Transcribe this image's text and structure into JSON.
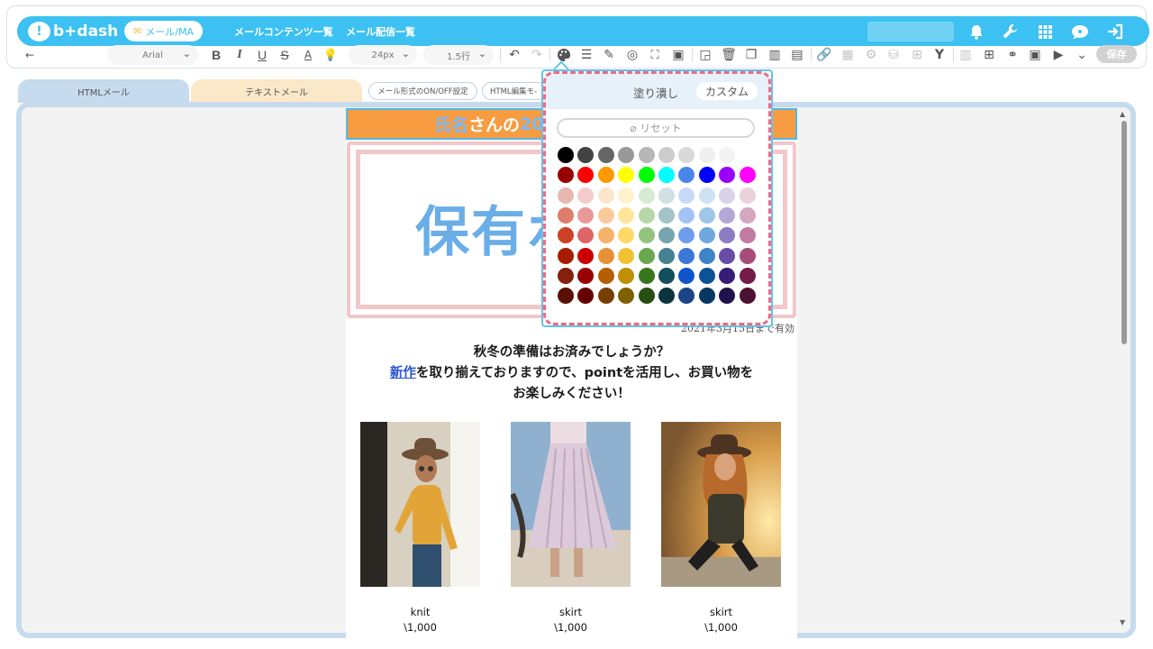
{
  "app": {
    "logo_text": "b+dash",
    "logo_mark": "!",
    "mail_pill": "メール/MA",
    "nav": {
      "contents_list": "メールコンテンツ一覧",
      "delivery_list": "メール配信一覧"
    },
    "nav_icons": [
      "bell-icon",
      "wrench-icon",
      "grid-icon",
      "chat-icon",
      "logout-icon"
    ],
    "accent": "#3cc1f2"
  },
  "toolbar": {
    "back": "←",
    "font_select": "Arial",
    "size_select": "24px",
    "line_height_select": "1.5行",
    "save_label": "保存"
  },
  "tabs": {
    "html_mail": "HTMLメール",
    "text_mail": "テキストメール",
    "onoff_btn": "メール形式のON/OFF設定",
    "html_edit_btn": "HTML編集モ-"
  },
  "email": {
    "header_name": "氏名",
    "header_suffix": "さんの",
    "header_number": "20",
    "coupon_text": "保有ポ",
    "expiry": "2021年3月15日まで有効",
    "message_line1": "秋冬の準備はお済みでしょうか？",
    "message_link": "新作",
    "message_line2_rest": "を取り揃えておりますので、pointを活用し、お買い物を",
    "message_line3": "お楽しみください！",
    "products": [
      {
        "name": "knit",
        "price": "\\1,000"
      },
      {
        "name": "skirt",
        "price": "\\1,000"
      },
      {
        "name": "skirt",
        "price": "\\1,000"
      }
    ]
  },
  "color_picker": {
    "fill_label": "塗り潰し",
    "custom_label": "カスタム",
    "reset_label": "リセット",
    "palette": [
      [
        "#000000",
        "#434343",
        "#666666",
        "#999999",
        "#b7b7b7",
        "#cccccc",
        "#d9d9d9",
        "#efefef",
        "#f3f3f3",
        "#ffffff"
      ],
      [
        "#980000",
        "#ff0000",
        "#ff9900",
        "#ffff00",
        "#00ff00",
        "#00ffff",
        "#4a86e8",
        "#0000ff",
        "#9900ff",
        "#ff00ff"
      ],
      [
        "#e6b8af",
        "#f4cccc",
        "#fce5cd",
        "#fff2cc",
        "#d9ead3",
        "#d0e0e3",
        "#c9daf8",
        "#cfe2f3",
        "#d9d2e9",
        "#ead1dc"
      ],
      [
        "#dd7e6b",
        "#ea9999",
        "#f9cb9c",
        "#ffe599",
        "#b6d7a8",
        "#a2c4c9",
        "#a4c2f4",
        "#9fc5e8",
        "#b4a7d6",
        "#d5a6bd"
      ],
      [
        "#cc4125",
        "#e06666",
        "#f6b26b",
        "#ffd966",
        "#93c47d",
        "#76a5af",
        "#6d9eeb",
        "#6fa8dc",
        "#8e7cc3",
        "#c27ba0"
      ],
      [
        "#a61c00",
        "#cc0000",
        "#e69138",
        "#f1c232",
        "#6aa84f",
        "#45818e",
        "#3c78d8",
        "#3d85c6",
        "#674ea7",
        "#a64d79"
      ],
      [
        "#85200c",
        "#990000",
        "#b45f06",
        "#bf9000",
        "#38761d",
        "#134f5c",
        "#1155cc",
        "#0b5394",
        "#351c75",
        "#741b47"
      ],
      [
        "#5b0f00",
        "#660000",
        "#783f04",
        "#7f6000",
        "#274e13",
        "#0c343d",
        "#1c4587",
        "#073763",
        "#20124d",
        "#4c1130"
      ]
    ]
  }
}
